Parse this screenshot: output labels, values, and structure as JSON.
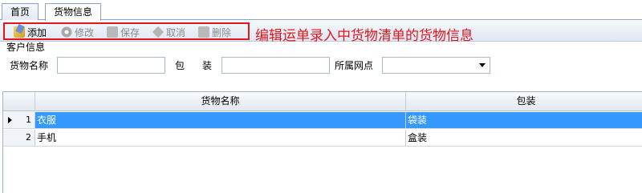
{
  "tabs": [
    {
      "label": "首页"
    },
    {
      "label": "货物信息"
    }
  ],
  "toolbar": {
    "add": "添加",
    "edit": "修改",
    "save": "保存",
    "cancel": "取消",
    "delete": "删除"
  },
  "annotation": "编辑运单录入中货物清单的货物信息",
  "accent_color": "#e0171b",
  "selection_color": "#3399ff",
  "customer_panel": {
    "title": "客户信息",
    "goods_name_label": "货物名称",
    "package_label": "包装",
    "site_label": "所属网点",
    "goods_name_value": "",
    "package_value": "",
    "site_value": ""
  },
  "grid": {
    "columns": [
      "货物名称",
      "包装"
    ],
    "rows": [
      {
        "index": "1",
        "name": "衣服",
        "package": "袋装",
        "selected": true
      },
      {
        "index": "2",
        "name": "手机",
        "package": "盒装",
        "selected": false
      }
    ]
  }
}
